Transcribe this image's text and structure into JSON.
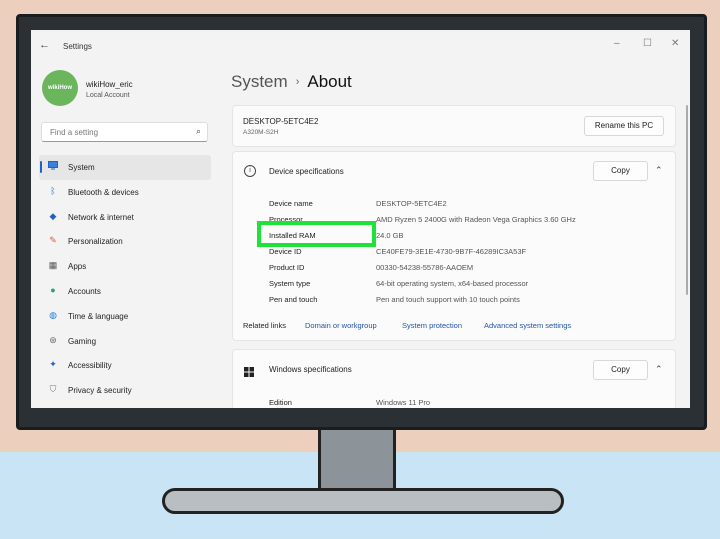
{
  "window": {
    "title": "Settings",
    "controls": [
      "–",
      "☐",
      "✕"
    ]
  },
  "user": {
    "avatar_text": "wikiHow",
    "name": "wikiHow_eric",
    "account_type": "Local Account"
  },
  "search": {
    "placeholder": "Find a setting"
  },
  "sidebar": {
    "items": [
      {
        "label": "System",
        "icon": "display-icon",
        "active": true
      },
      {
        "label": "Bluetooth & devices",
        "icon": "bluetooth-icon"
      },
      {
        "label": "Network & internet",
        "icon": "wifi-icon"
      },
      {
        "label": "Personalization",
        "icon": "brush-icon"
      },
      {
        "label": "Apps",
        "icon": "apps-icon"
      },
      {
        "label": "Accounts",
        "icon": "person-icon"
      },
      {
        "label": "Time & language",
        "icon": "globe-icon"
      },
      {
        "label": "Gaming",
        "icon": "controller-icon"
      },
      {
        "label": "Accessibility",
        "icon": "accessibility-icon"
      },
      {
        "label": "Privacy & security",
        "icon": "shield-icon"
      }
    ]
  },
  "breadcrumb": {
    "parent": "System",
    "current": "About"
  },
  "device_card": {
    "name": "DESKTOP-5ETC4E2",
    "model": "A320M-S2H",
    "rename_label": "Rename this PC"
  },
  "device_specs": {
    "title": "Device specifications",
    "copy_label": "Copy",
    "rows": [
      {
        "label": "Device name",
        "value": "DESKTOP-5ETC4E2"
      },
      {
        "label": "Processor",
        "value": "AMD Ryzen 5 2400G with Radeon Vega Graphics      3.60 GHz"
      },
      {
        "label": "Installed RAM",
        "value": "24.0 GB"
      },
      {
        "label": "Device ID",
        "value": "CE40FE79-3E1E-4730-9B7F-46289IC3A53F"
      },
      {
        "label": "Product ID",
        "value": "00330-54238-55786-AAOEM"
      },
      {
        "label": "System type",
        "value": "64-bit operating system, x64-based processor"
      },
      {
        "label": "Pen and touch",
        "value": "Pen and touch support with 10 touch points"
      }
    ]
  },
  "related_links": {
    "label": "Related links",
    "links": [
      "Domain or workgroup",
      "System protection",
      "Advanced system settings"
    ]
  },
  "windows_specs": {
    "title": "Windows specifications",
    "copy_label": "Copy",
    "rows": [
      {
        "label": "Edition",
        "value": "Windows 11 Pro"
      }
    ]
  },
  "colors": {
    "accent": "#1f63c6",
    "highlight": "#1de338",
    "avatar": "#6bb55c"
  }
}
